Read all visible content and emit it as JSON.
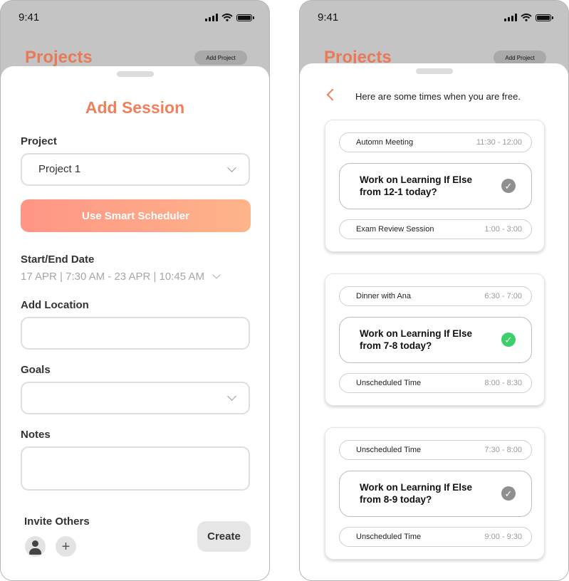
{
  "status": {
    "time": "9:41"
  },
  "background": {
    "title": "Projects",
    "add_project_label": "Add Project"
  },
  "add_session": {
    "title": "Add Session",
    "project_label": "Project",
    "project_value": "Project 1",
    "smart_scheduler_label": "Use Smart Scheduler",
    "date_label": "Start/End Date",
    "date_value": "17 APR | 7:30 AM - 23 APR | 10:45 AM",
    "location_label": "Add Location",
    "location_value": "",
    "goals_label": "Goals",
    "goals_value": "",
    "notes_label": "Notes",
    "notes_value": "",
    "invite_label": "Invite Others",
    "create_label": "Create",
    "smart_gradient": [
      "#fe9585",
      "#feb48a"
    ]
  },
  "free_times": {
    "title": "Here are some times when you are free.",
    "cards": [
      {
        "before": {
          "name": "Automn Meeting",
          "time": "11:30 - 12:00"
        },
        "suggestion": "Work on Learning If Else from 12-1 today?",
        "selected": false,
        "after": {
          "name": "Exam Review Session",
          "time": "1:00 - 3:00"
        }
      },
      {
        "before": {
          "name": "Dinner with Ana",
          "time": "6:30 - 7:00"
        },
        "suggestion": "Work on Learning If Else from 7-8 today?",
        "selected": true,
        "after": {
          "name": "Unscheduled Time",
          "time": "8:00 - 8:30"
        }
      },
      {
        "before": {
          "name": "Unscheduled Time",
          "time": "7:30 - 8:00"
        },
        "suggestion": "Work on Learning If Else from 8-9 today?",
        "selected": false,
        "after": {
          "name": "Unscheduled Time",
          "time": "9:00 - 9:30"
        }
      }
    ]
  },
  "colors": {
    "accent": "#f07f5c",
    "check_selected": "#3ccf6b",
    "check_unselected": "#8f8f8f"
  }
}
